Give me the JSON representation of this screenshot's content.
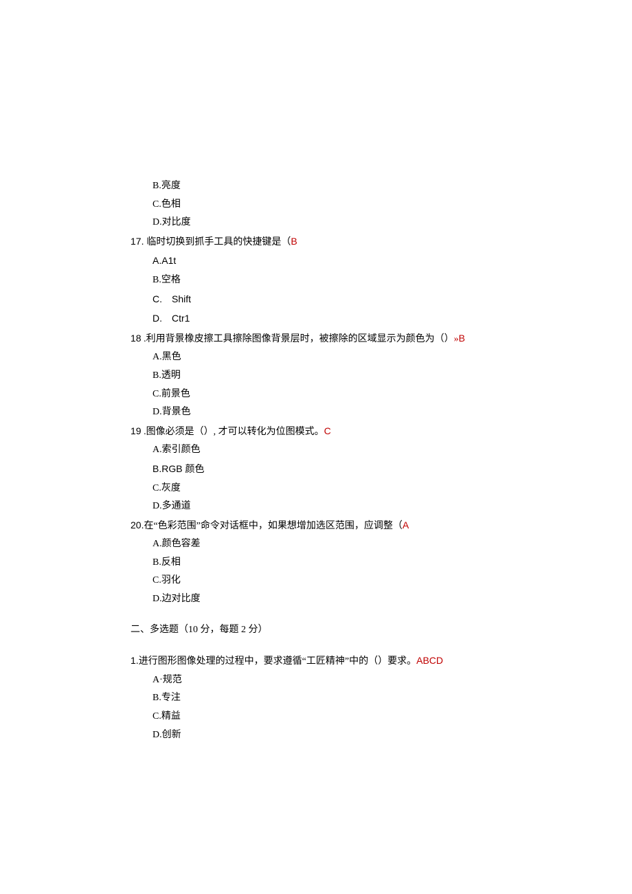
{
  "q16": {
    "optB": "B.亮度",
    "optC": "C.色相",
    "optD": "D.对比度"
  },
  "q17": {
    "num": "17. ",
    "stem": "临时切换到抓手工具的快捷键是（",
    "ans": "B",
    "optA_label": "A.",
    "optA_text": "A1t",
    "optB": "B.空格",
    "optC_label": "C.",
    "optC_text": "Shift",
    "optD_label": "D.",
    "optD_text": "Ctr1"
  },
  "q18": {
    "num": "18",
    "stem": " .利用背景橡皮擦工具擦除图像背景层时，被擦除的区域显示为颜色为（）",
    "post": "»",
    "ans": "B",
    "optA": "A.黑色",
    "optB": "B.透明",
    "optC": "C.前景色",
    "optD": "D.背景色"
  },
  "q19": {
    "num": "19",
    "stem": " .图像必须是（）, 才可以转化为位图模式。",
    "ans": "C",
    "optA": "A.索引颜色",
    "optB_label": "B.",
    "optB_text": "RGB 颜色",
    "optC": "C.灰度",
    "optD": "D.多通道"
  },
  "q20": {
    "num": "20.",
    "stem": "在“色彩范围”命令对话框中，如果想增加选区范围，应调整（",
    "ans": "A",
    "optA": "A.颜色容差",
    "optB": "B.反相",
    "optC": "C.羽化",
    "optD": "D.边对比度"
  },
  "section2": "二、多选题（10 分，每题 2 分）",
  "mq1": {
    "num": "1.",
    "stem": "进行图形图像处理的过程中，要求遵循“工匠精神”中的（）要求。",
    "ans": "ABCD",
    "optA": "A·规范",
    "optB": "B.专注",
    "optC": "C.精益",
    "optD": "D.创新"
  }
}
